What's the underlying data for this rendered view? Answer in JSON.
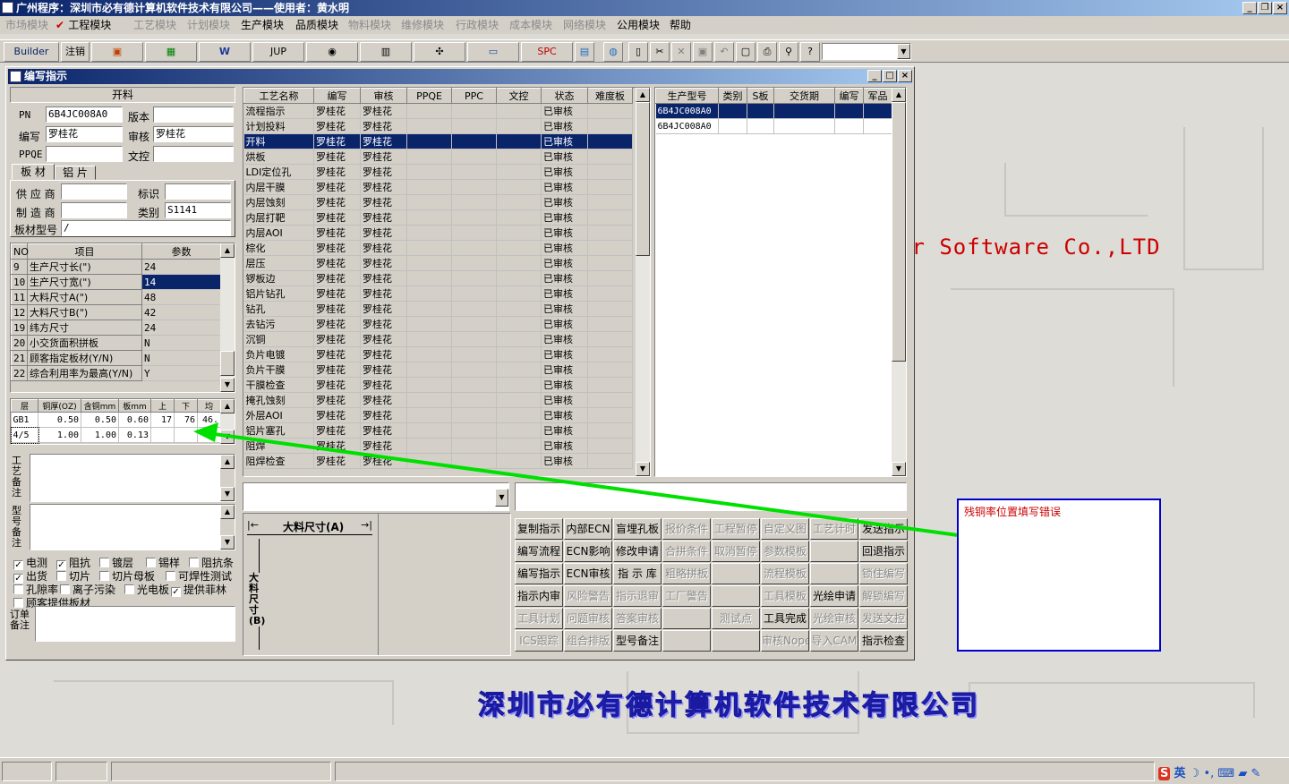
{
  "app_title": "广州程序：深圳市必有德计算机软件技术有限公司——使用者：黄水明",
  "menu": [
    "市场模块",
    "工程模块",
    "工艺模块",
    "计划模块",
    "生产模块",
    "品质模块",
    "物料模块",
    "维修模块",
    "行政模块",
    "成本模块",
    "网络模块",
    "公用模块",
    "帮助"
  ],
  "menu_disabled": [
    true,
    false,
    true,
    true,
    false,
    false,
    true,
    true,
    true,
    true,
    true,
    false,
    false
  ],
  "toolbar": {
    "builder": "Builder",
    "logout": "注销",
    "jup": "JUP",
    "spc": "SPC"
  },
  "window_title": "编写指示",
  "left": {
    "header": "开料",
    "pn_label": "PN",
    "pn_value": "6B4JC008A0",
    "version_label": "版本",
    "version_value": "",
    "author_label": "编写",
    "author_value": "罗桂花",
    "reviewer_label": "审核",
    "reviewer_value": "罗桂花",
    "ppqe_label": "PPQE",
    "ppqe_value": "",
    "doc_label": "文控",
    "doc_value": "",
    "tabs": [
      "板 材",
      "铝 片"
    ],
    "supplier_label": "供 应 商",
    "mark_label": "标识",
    "maker_label": "制 造 商",
    "type_label": "类别",
    "type_value": "S1141",
    "board_model_label": "板材型号",
    "board_model_value": "/"
  },
  "param_table": {
    "headers": [
      "NO",
      "项目",
      "参数"
    ],
    "rows": [
      [
        "9",
        "生产尺寸长(\")",
        "24"
      ],
      [
        "10",
        "生产尺寸宽(\")",
        "14"
      ],
      [
        "11",
        "大料尺寸A(\")",
        "48"
      ],
      [
        "12",
        "大料尺寸B(\")",
        "42"
      ],
      [
        "19",
        "纬方尺寸",
        "24"
      ],
      [
        "20",
        "小交货面积拼板",
        "N"
      ],
      [
        "21",
        "顾客指定板材(Y/N)",
        "N"
      ],
      [
        "22",
        "综合利用率为最高(Y/N)",
        "Y"
      ]
    ],
    "selected_row": 1
  },
  "layer_table": {
    "headers": [
      "层",
      "铜厚(OZ)",
      "含铜mm",
      "板mm",
      "上",
      "下",
      "均"
    ],
    "rows": [
      [
        "GB1",
        "0.50",
        "0.50",
        "0.60",
        "17",
        "76",
        "46."
      ],
      [
        "4/5",
        "1.00",
        "1.00",
        "0.13",
        "",
        "",
        ""
      ]
    ]
  },
  "remarks": {
    "process": "工艺备注",
    "model": "型号备注",
    "order": "订单备注"
  },
  "checkboxes": [
    {
      "label": "电测",
      "checked": true
    },
    {
      "label": "阻抗",
      "checked": true
    },
    {
      "label": "镀层",
      "checked": false
    },
    {
      "label": "锡样",
      "checked": false
    },
    {
      "label": "阻抗条",
      "checked": false
    },
    {
      "label": "出货",
      "checked": true
    },
    {
      "label": "切片",
      "checked": false
    },
    {
      "label": "切片母板",
      "checked": false
    },
    {
      "label": "可焊性测试",
      "checked": false
    },
    {
      "label": "孔隙率",
      "checked": false
    },
    {
      "label": "离子污染",
      "checked": false
    },
    {
      "label": "光电板",
      "checked": false
    },
    {
      "label": "提供菲林",
      "checked": true
    },
    {
      "label": "顾客提供板材",
      "checked": false
    }
  ],
  "process_table": {
    "headers": [
      "工艺名称",
      "编写",
      "审核",
      "PPQE",
      "PPC",
      "文控",
      "状态",
      "难度板"
    ],
    "rows": [
      [
        "流程指示",
        "罗桂花",
        "罗桂花",
        "",
        "",
        "",
        "已审核",
        ""
      ],
      [
        "计划投料",
        "罗桂花",
        "罗桂花",
        "",
        "",
        "",
        "已审核",
        ""
      ],
      [
        "开料",
        "罗桂花",
        "罗桂花",
        "",
        "",
        "",
        "已审核",
        ""
      ],
      [
        "烘板",
        "罗桂花",
        "罗桂花",
        "",
        "",
        "",
        "已审核",
        ""
      ],
      [
        "LDI定位孔",
        "罗桂花",
        "罗桂花",
        "",
        "",
        "",
        "已审核",
        ""
      ],
      [
        "内层干膜",
        "罗桂花",
        "罗桂花",
        "",
        "",
        "",
        "已审核",
        ""
      ],
      [
        "内层蚀刻",
        "罗桂花",
        "罗桂花",
        "",
        "",
        "",
        "已审核",
        ""
      ],
      [
        "内层打靶",
        "罗桂花",
        "罗桂花",
        "",
        "",
        "",
        "已审核",
        ""
      ],
      [
        "内层AOI",
        "罗桂花",
        "罗桂花",
        "",
        "",
        "",
        "已审核",
        ""
      ],
      [
        "棕化",
        "罗桂花",
        "罗桂花",
        "",
        "",
        "",
        "已审核",
        ""
      ],
      [
        "层压",
        "罗桂花",
        "罗桂花",
        "",
        "",
        "",
        "已审核",
        ""
      ],
      [
        "锣板边",
        "罗桂花",
        "罗桂花",
        "",
        "",
        "",
        "已审核",
        ""
      ],
      [
        "铝片钻孔",
        "罗桂花",
        "罗桂花",
        "",
        "",
        "",
        "已审核",
        ""
      ],
      [
        "钻孔",
        "罗桂花",
        "罗桂花",
        "",
        "",
        "",
        "已审核",
        ""
      ],
      [
        "去钻污",
        "罗桂花",
        "罗桂花",
        "",
        "",
        "",
        "已审核",
        ""
      ],
      [
        "沉铜",
        "罗桂花",
        "罗桂花",
        "",
        "",
        "",
        "已审核",
        ""
      ],
      [
        "负片电镀",
        "罗桂花",
        "罗桂花",
        "",
        "",
        "",
        "已审核",
        ""
      ],
      [
        "负片干膜",
        "罗桂花",
        "罗桂花",
        "",
        "",
        "",
        "已审核",
        ""
      ],
      [
        "干膜检查",
        "罗桂花",
        "罗桂花",
        "",
        "",
        "",
        "已审核",
        ""
      ],
      [
        "掩孔蚀刻",
        "罗桂花",
        "罗桂花",
        "",
        "",
        "",
        "已审核",
        ""
      ],
      [
        "外层AOI",
        "罗桂花",
        "罗桂花",
        "",
        "",
        "",
        "已审核",
        ""
      ],
      [
        "铝片塞孔",
        "罗桂花",
        "罗桂花",
        "",
        "",
        "",
        "已审核",
        ""
      ],
      [
        "阻焊",
        "罗桂花",
        "罗桂花",
        "",
        "",
        "",
        "已审核",
        ""
      ],
      [
        "阻焊检查",
        "罗桂花",
        "罗桂花",
        "",
        "",
        "",
        "已审核",
        ""
      ]
    ],
    "selected_row": 2
  },
  "model_table": {
    "headers": [
      "生产型号",
      "类别",
      "S板",
      "交货期",
      "编写",
      "军品"
    ],
    "rows": [
      [
        "6B4JC008A0",
        "",
        "",
        "",
        "",
        ""
      ],
      [
        "6B4JC008A0",
        "",
        "",
        "",
        "",
        ""
      ]
    ],
    "selected_row": 0
  },
  "dimension": {
    "a_label": "大料尺寸(A)",
    "b_label": "大料尺寸(B)"
  },
  "action_buttons": [
    [
      {
        "t": "复制指示",
        "d": false
      },
      {
        "t": "内部ECN",
        "d": false
      },
      {
        "t": "盲埋孔板",
        "d": false
      },
      {
        "t": "报价条件",
        "d": true
      },
      {
        "t": "工程暂停",
        "d": true
      },
      {
        "t": "自定义图",
        "d": true
      },
      {
        "t": "工艺计时",
        "d": true
      },
      {
        "t": "发送指示",
        "d": false
      }
    ],
    [
      {
        "t": "编写流程",
        "d": false
      },
      {
        "t": "ECN影响",
        "d": false
      },
      {
        "t": "修改申请",
        "d": false
      },
      {
        "t": "合拼条件",
        "d": true
      },
      {
        "t": "取消暂停",
        "d": true
      },
      {
        "t": "参数模板",
        "d": true
      },
      {
        "t": "",
        "d": true
      },
      {
        "t": "回退指示",
        "d": false
      }
    ],
    [
      {
        "t": "编写指示",
        "d": false
      },
      {
        "t": "ECN审核",
        "d": false
      },
      {
        "t": "指 示 库",
        "d": false
      },
      {
        "t": "粗略拼板",
        "d": true
      },
      {
        "t": "",
        "d": true
      },
      {
        "t": "流程模板",
        "d": true
      },
      {
        "t": "",
        "d": true
      },
      {
        "t": "锁住编写",
        "d": true
      }
    ],
    [
      {
        "t": "指示内审",
        "d": false
      },
      {
        "t": "风险警告",
        "d": true
      },
      {
        "t": "指示退审",
        "d": true
      },
      {
        "t": "工厂警告",
        "d": true
      },
      {
        "t": "",
        "d": true
      },
      {
        "t": "工具模板",
        "d": true
      },
      {
        "t": "光绘申请",
        "d": false
      },
      {
        "t": "解锁编写",
        "d": true
      }
    ],
    [
      {
        "t": "工具计划",
        "d": true
      },
      {
        "t": "问题审核",
        "d": true
      },
      {
        "t": "答案审核",
        "d": true
      },
      {
        "t": "",
        "d": true
      },
      {
        "t": "测试点",
        "d": true
      },
      {
        "t": "工具完成",
        "d": false
      },
      {
        "t": "光绘审核",
        "d": true
      },
      {
        "t": "发送文控",
        "d": true
      }
    ],
    [
      {
        "t": "ICS跟踪",
        "d": true
      },
      {
        "t": "组合排版",
        "d": true
      },
      {
        "t": "型号备注",
        "d": false
      },
      {
        "t": "",
        "d": true
      },
      {
        "t": "",
        "d": true
      },
      {
        "t": "审核Nope",
        "d": true
      },
      {
        "t": "导入CAM",
        "d": true
      },
      {
        "t": "指示检查",
        "d": false
      }
    ]
  ],
  "callout_text": "残铜率位置填写错误",
  "banner_text": "er Software Co.,LTD",
  "bottom_banner": "深圳市必有德计算机软件技术有限公司",
  "tray": {
    "ime": "英"
  },
  "colors": {
    "title_blue": "#0a246a",
    "selection": "#0a246a",
    "arrow": "#00e000",
    "callout_border": "#0000cc",
    "callout_text": "#cc0000"
  }
}
